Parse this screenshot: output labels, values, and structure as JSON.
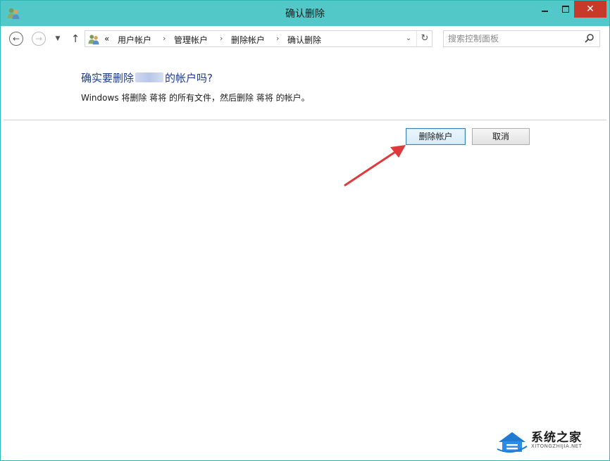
{
  "window": {
    "title": "确认删除"
  },
  "toolbar": {
    "back_icon": "back-arrow-icon",
    "forward_icon": "forward-arrow-icon",
    "recent_icon": "chevron-down-icon",
    "up_icon": "up-arrow-icon",
    "address": {
      "overflow": "«",
      "crumbs": [
        "用户帐户",
        "管理帐户",
        "删除帐户",
        "确认删除"
      ],
      "separator": "›"
    },
    "search": {
      "placeholder": "搜索控制面板"
    }
  },
  "main": {
    "headline_prefix": "确实要删除",
    "headline_suffix": "的帐户吗?",
    "description": "Windows 将删除 蒋将 的所有文件，然后删除 蒋将 的帐户。",
    "delete_button": "删除帐户",
    "cancel_button": "取消"
  },
  "watermark": {
    "brand": "系统之家",
    "url": "XITONGZHIJIA.NET"
  },
  "colors": {
    "titlebar": "#53c8c8",
    "close": "#c7392b",
    "heading": "#1e3a8a",
    "arrow": "#e0393b"
  }
}
